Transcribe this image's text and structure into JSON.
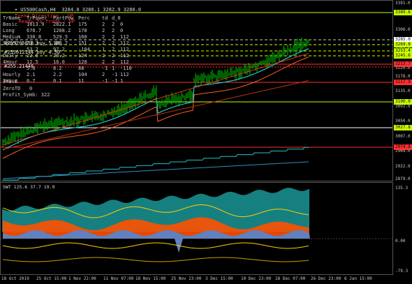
{
  "header": {
    "symbol_line": "US500Cash,H4  3284.0 3286.1 3282.9 3286.0",
    "trend_direction": "Trend Direction : UP",
    "ready_to_trade": "Ready To Trade : UP"
  },
  "stats_table": {
    "columns": [
      "TrName",
      "TrPower",
      "PartPow",
      "Perc",
      "td",
      "d_0"
    ],
    "rows": [
      [
        "Basic",
        "1613.9",
        "2822.1",
        "175",
        "2",
        "2",
        "0"
      ],
      [
        "Long",
        "678.7",
        "1208.2",
        "178",
        "2",
        "2",
        "0"
      ],
      [
        "Medium",
        "330.8",
        "529.5",
        "160",
        "2",
        "2",
        "112"
      ],
      [
        "Short",
        "73.3",
        "108.7",
        "151",
        "2",
        "2",
        "112"
      ],
      [
        "",
        "53.7",
        "97.2",
        "-104",
        "1",
        "2",
        "112"
      ],
      [
        "Daily",
        "22.6",
        "28.2",
        "124",
        "2",
        "2",
        "112"
      ],
      [
        "4Hour",
        "12.5",
        "16.0",
        "128",
        "2",
        "2",
        "112"
      ],
      [
        "",
        "5.8",
        "8.2",
        "88",
        "-1",
        "1",
        "-110"
      ],
      [
        "Hourly",
        "2.1",
        "2.2",
        "104",
        "2",
        "-1",
        "112"
      ],
      [
        "1Hour",
        "0.7",
        "0.1",
        "11",
        "-1",
        "-1",
        "1"
      ]
    ],
    "extra_labels": [
      "#255206818 buy 5.40",
      "#255612144 buy 4.50",
      "#255.21448"
    ],
    "v_line": "V=3.8",
    "zero_td": "ZeroTD",
    "zero_val": "0",
    "profit": "Profit_Symb: 322"
  },
  "price_axis": {
    "labels": [
      "3306.0",
      "3263.0",
      "3220.0",
      "3178.0",
      "3135.0",
      "3092.0",
      "3050.0",
      "3007.0",
      "2964.0",
      "2922.0",
      "2879.0"
    ],
    "tags": [
      {
        "text": "3389.6",
        "color": "#c8ff00"
      },
      {
        "text": "3285.0",
        "color": "#ffffff"
      },
      {
        "text": "3269.8",
        "color": "#c8ff00"
      },
      {
        "text": "3253.4",
        "color": "#c8ff00"
      },
      {
        "text": "3245.6",
        "color": "#c8ff00"
      },
      {
        "text": "3213.7",
        "color": "#ff3030"
      },
      {
        "text": "3157.9",
        "color": "#ff3030"
      },
      {
        "text": "3100.0",
        "color": "#c8ff00"
      },
      {
        "text": "3027.8",
        "color": "#c8ff00"
      },
      {
        "text": "2974.8",
        "color": "#ff3030"
      }
    ],
    "top_label": "3391.0"
  },
  "indicator": {
    "label": "SWT 125.6 37.7 19.9",
    "axis_top": "135.3",
    "axis_zero": "0.00",
    "axis_bottom": "-79.3"
  },
  "time_axis": {
    "labels": [
      "18 Oct 2019",
      "25 Oct 15:00",
      "1 Nov 22:00",
      "11 Nov 07:00",
      "18 Nov 15:00",
      "25 Nov 23:00",
      "3 Dec 15:00",
      "10 Dec 23:00",
      "18 Dec 07:00",
      "26 Dec 23:00",
      "6 Jan 15:00"
    ]
  },
  "colors": {
    "background": "#000000",
    "candles": "#00c000",
    "lime_line": "#c8ff00",
    "red_line": "#ff3030",
    "cyan_line": "#20c8c8",
    "orange_line": "#e05010",
    "histogram_teal": "#168080",
    "orange_fill": "#ff5000",
    "blue_fill": "#6080c0"
  }
}
